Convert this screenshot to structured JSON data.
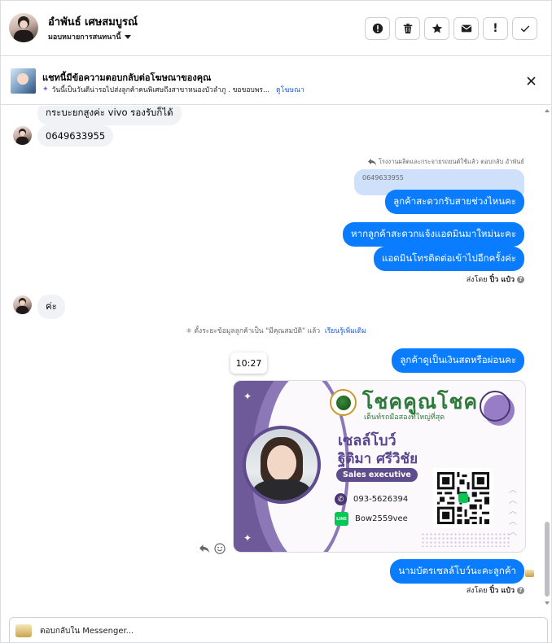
{
  "header": {
    "contact_name": "อำพันธ์ เศษสมบูรณ์",
    "assign_label": "มอบหมายการสนทนานี้",
    "buttons": [
      {
        "name": "mark-spam",
        "icon": "alert-circle-icon"
      },
      {
        "name": "delete",
        "icon": "trash-icon"
      },
      {
        "name": "star",
        "icon": "star-icon"
      },
      {
        "name": "mark-unread",
        "icon": "envelope-icon"
      },
      {
        "name": "follow-up",
        "icon": "exclamation-icon",
        "glyph": "!"
      },
      {
        "name": "mark-done",
        "icon": "check-icon"
      }
    ]
  },
  "ad_banner": {
    "title": "แชทนี้มีข้อความตอบกลับต่อโฆษณาของคุณ",
    "snippet": "วันนี้เป็นวันดีน่ารอไปส่งลูกค้าคนพิเศษถึงสาขาหนองบัวลำภู . ขอขอบพร...",
    "link_label": "ดูโฆษณา"
  },
  "thread": {
    "incoming_1": "กระบะยกสูงค่ะ vivo รองรับก็ได้",
    "incoming_2": "0649633955",
    "reply_note": "โรงงานผลิตและกระจายรถยนต์ใช้แล้ว ตอบกลับ อำพันธ์",
    "quoted_text": "0649633955",
    "outgoing_1": "ลูกค้าสะดวกรับสายช่วงไหนคะ",
    "outgoing_2": "หากลูกค้าสะดวกแจ้งแอดมินมาใหม่นะคะ",
    "outgoing_3": "แอดมินโทรติดต่อเข้าไปอีกครั้งค่ะ",
    "sent_by_prefix": "ส่งโดย",
    "sent_by_name": "ปิ๋ว แป๋ว",
    "incoming_3": "ค่ะ",
    "system_note": "ตั้งระยะข้อมูลลูกค้าเป็น \"มีคุณสมบัติ\" แล้ว",
    "system_link": "เรียนรู้เพิ่มเติม",
    "timestamp": "10:27",
    "outgoing_4": "ลูกค้าดูเป็นเงินสดหรือผ่อนคะ",
    "outgoing_5": "นามบัตรเซลล์โบว์นะคะลูกค้า",
    "sent_by_prefix_2": "ส่งโดย",
    "sent_by_name_2": "ปิ๋ว แป๋ว"
  },
  "business_card": {
    "brand": "โชคคูณโชค",
    "tagline": "เต็นท์รถมือสองที่ใหญ่ที่สุด",
    "nickname": "เซลล์โบว์",
    "full_name": "ฐิติมา ศรีวิชัย",
    "role": "Sales executive",
    "phone": "093-5626394",
    "line_label": "LINE",
    "line_id": "Bow2559vee",
    "colors": {
      "primary": "#5e4c8c",
      "brand_green": "#2d7a3a"
    }
  },
  "composer": {
    "placeholder": "ตอบกลับใน Messenger..."
  },
  "colors": {
    "outgoing_bubble": "#0a7cff",
    "incoming_bubble": "#f0f2f5",
    "quoted_bubble": "#cfe0fb"
  }
}
